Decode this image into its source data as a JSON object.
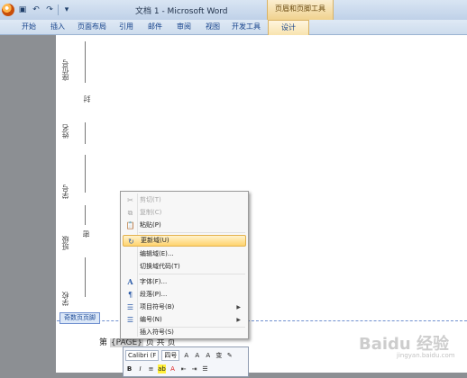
{
  "window": {
    "title": "文档 1 - Microsoft Word",
    "context_group": "页眉和页脚工具"
  },
  "ribbon_tabs": [
    "开始",
    "插入",
    "页面布局",
    "引用",
    "邮件",
    "审阅",
    "视图",
    "开发工具",
    "设计"
  ],
  "document": {
    "vertical_labels": [
      "座位号",
      "封",
      "姓名",
      "学号",
      "班级",
      "密",
      "学校"
    ],
    "footer_tag": "奇数页页脚",
    "field_prefix": "第",
    "field_code": "{PAGE}",
    "field_suffix": "页 共 页"
  },
  "context_menu": {
    "items": [
      {
        "label": "剪切(T)",
        "icon": "cut-icon",
        "glyph": "✂",
        "disabled": true
      },
      {
        "label": "复制(C)",
        "icon": "copy-icon",
        "glyph": "⧉",
        "disabled": true
      },
      {
        "label": "粘贴(P)",
        "icon": "paste-icon",
        "glyph": "📋",
        "disabled": false
      },
      {
        "label": "更新域(U)",
        "icon": "update-field-icon",
        "glyph": "↻",
        "highlighted": true
      },
      {
        "label": "编辑域(E)...",
        "icon": "",
        "glyph": ""
      },
      {
        "label": "切换域代码(T)",
        "icon": "",
        "glyph": ""
      },
      {
        "label": "字体(F)...",
        "icon": "font-icon",
        "glyph": "A"
      },
      {
        "label": "段落(P)...",
        "icon": "paragraph-icon",
        "glyph": "¶"
      },
      {
        "label": "项目符号(B)",
        "icon": "bullets-icon",
        "glyph": "☰",
        "submenu": true
      },
      {
        "label": "编号(N)",
        "icon": "numbering-icon",
        "glyph": "☰",
        "submenu": true
      },
      {
        "label": "插入符号(S)",
        "icon": "",
        "glyph": ""
      }
    ]
  },
  "mini_toolbar": {
    "font": "Calibri (F",
    "size": "四号",
    "row2": [
      "B",
      "I",
      "≡",
      "ab",
      "A",
      "⇤",
      "⇥",
      "☰"
    ]
  },
  "watermark": {
    "text": "Baidu 经验",
    "sub": "jingyan.baidu.com"
  },
  "colors": {
    "highlight": "#ffd36d",
    "context_tab": "#f0d28e",
    "footer_border": "#6f8fcf"
  }
}
